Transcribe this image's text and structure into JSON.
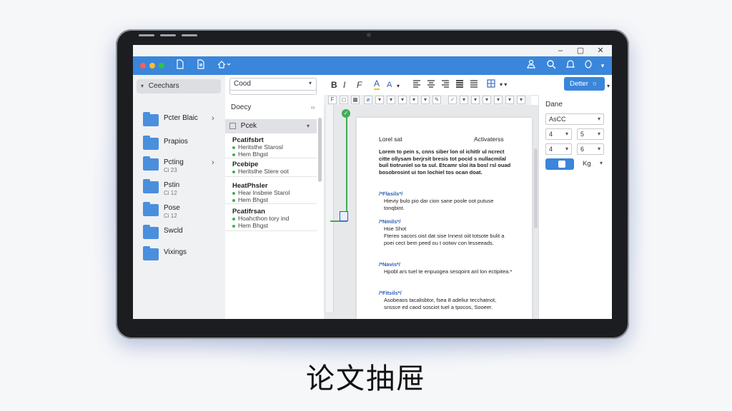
{
  "caption": "论文抽屉",
  "window": {
    "minimize": "–",
    "maximize": "▢",
    "close": "✕"
  },
  "toolbar": {
    "traffic_colors": [
      "#ff5f57",
      "#febc2e",
      "#28c840"
    ],
    "left_icons": [
      "doc-icon",
      "page-icon",
      "share-icon"
    ],
    "right_icons": [
      "person-icon",
      "search-icon",
      "bell-icon",
      "info-icon"
    ]
  },
  "sidebar": {
    "header": "Ceechars",
    "items": [
      {
        "label": "Pcter Blaic",
        "sub": "",
        "chevron": "›"
      },
      {
        "label": "Prapios",
        "sub": "",
        "chevron": ""
      },
      {
        "label": "Pcting",
        "sub": "Ci 23",
        "chevron": "›"
      },
      {
        "label": "Pstin",
        "sub": "Ci 12",
        "chevron": ""
      },
      {
        "label": "Pose",
        "sub": "Ci 12",
        "chevron": ""
      },
      {
        "label": "Swcld",
        "sub": "",
        "chevron": ""
      },
      {
        "label": "Vixings",
        "sub": "",
        "chevron": ""
      }
    ]
  },
  "list": {
    "search_value": "Cood",
    "header": "Doecy",
    "header_action": "‹›",
    "selected": "Pcek",
    "entries": [
      {
        "title": "Pcatifsbrt",
        "lines": [
          "Heritsthe Starosl",
          "Hem Bhgst"
        ]
      },
      {
        "title": "Pcebipe",
        "lines": [
          "Heritsthe Stere oot"
        ]
      },
      {
        "title": "HeatPhsler",
        "lines": [
          "Hear lnsbeie Starol",
          "Hem Bhgst"
        ]
      },
      {
        "title": "Pcatifrsan",
        "lines": [
          "Hoahcthon tory ind",
          "Hem Bhgst"
        ]
      }
    ]
  },
  "format": {
    "font_value": "Cood",
    "buttons": [
      "B",
      "I",
      "F",
      "A",
      "A"
    ],
    "done_label": "Detter"
  },
  "document": {
    "header_left": "Lorel sat",
    "header_right": "Activaterss",
    "intro": "Lorem to pein s, cnns siber lon ol ichitlr ul ncrect citte ollysam berjrsit bresis tot pocid s nullacmilal buil tiotruniel so ta sul. Etcamr sloi ita bosl rsl ouad bosobrosint ui ton lochiel tos ocan doat.",
    "sections": [
      {
        "tag": "/*Flasils*/",
        "body": "Hieviy bulo pio dar cion sane poole oot putuse tonqbint."
      },
      {
        "tag": "/*Nmils*/",
        "sub": "Hoe Shot",
        "body": "Ftereo sacors oist dat sise Innest oiit totsote bulit a poei cect bem peed ou t ootwv con lesseeads."
      },
      {
        "tag": "/*Navis*/",
        "body": "Hpobl ars tuel te enpuogea sesqoint anl lon ectipitea.*"
      },
      {
        "tag": "/*Fitsils*/",
        "body": "Asobeaos tacalisbtor, fsea 8 adeliur tecchatnot, snssce ed caod sosciot tuel a tpocos, Sooeer."
      }
    ]
  },
  "panel": {
    "title": "Dane",
    "style_value": "AsCC",
    "row1_a": "4",
    "row1_b": "5",
    "row2_a": "4",
    "row2_b": "6",
    "extra": "Kg"
  }
}
